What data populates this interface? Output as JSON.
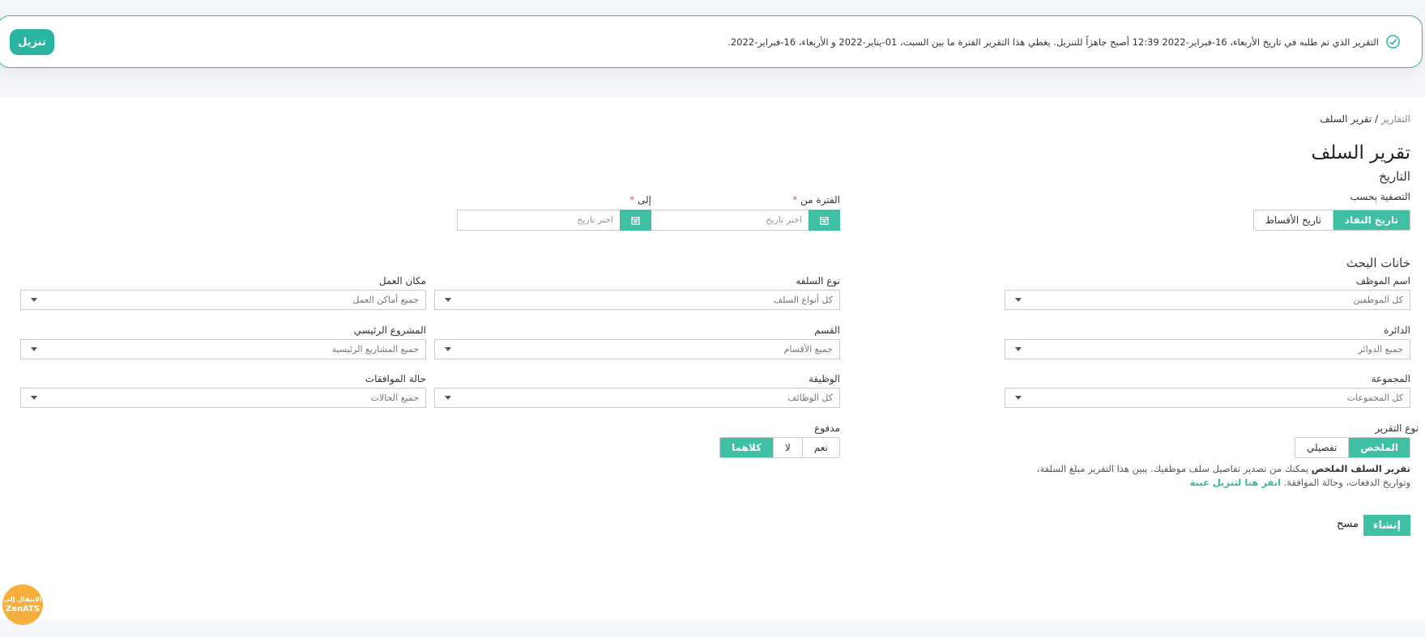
{
  "banner": {
    "message": "التقرير الذي تم طلبه في تاريخ الأربعاء، 16-فبراير-2022 12:39 أصبح جاهزاً للتنزيل. يغطي هذا التقرير الفترة ما بين السبت، 01-يناير-2022 و الأربعاء، 16-فبراير-2022.",
    "download_label": "تنزيل",
    "accent": "#29b59f"
  },
  "breadcrumb": {
    "root": "التقارير",
    "separator": " / ",
    "current": "تقرير السلف"
  },
  "page_title": "تقرير السلف",
  "date_section": {
    "title": "التاريخ",
    "filter_label": "التصفية بحسب",
    "filter_options": [
      "تاريخ النفاذ",
      "تاريخ الأقساط"
    ],
    "filter_selected": "تاريخ النفاذ",
    "from_label": "الفترة من",
    "to_label": "إلى",
    "required_mark": "*",
    "date_placeholder": "اختر تاريخ"
  },
  "search_section": {
    "title": "خانات البحث",
    "fields": {
      "employee": {
        "label": "اسم الموظف",
        "value": "كل الموظفين"
      },
      "loan_type": {
        "label": "نوع السلفه",
        "value": "كل أنواع السلف"
      },
      "workplace": {
        "label": "مكان العمل",
        "value": "جميع أماكن العمل"
      },
      "directorate": {
        "label": "الدائرة",
        "value": "جميع الدوائر"
      },
      "department": {
        "label": "القسم",
        "value": "جميع الأقسام"
      },
      "main_project": {
        "label": "المشروع الرئيسي",
        "value": "جميع المشاريع الرئيسية"
      },
      "group": {
        "label": "المجموعة",
        "value": "كل المجموعات"
      },
      "job": {
        "label": "الوظيفة",
        "value": "كل الوظائف"
      },
      "approval_status": {
        "label": "حالة الموافقات",
        "value": "جميع الحالات"
      }
    }
  },
  "report_type": {
    "label": "نوع التقرير",
    "options": [
      "الملخص",
      "تفصيلي"
    ],
    "selected": "الملخص"
  },
  "paid": {
    "label": "مدفوع",
    "options": [
      "نعم",
      "لا",
      "كلاهما"
    ],
    "selected": "كلاهما"
  },
  "description": {
    "bold": "تقرير السلف الملخص",
    "text": " يمكنك من تصدير تفاصيل سلف موظفيك. يبين هذا التقرير مبلغ السلفة، وتواريخ الدفعات، وحالة الموافقة. ",
    "link": "انقر هنا لتنزيل عينة"
  },
  "actions": {
    "create_label": "إنشاء",
    "clear_label": "مسح"
  },
  "zen_badge": {
    "line1": "الانتقال إلى",
    "line2": "ZenATS",
    "color": "#f6ae3c"
  },
  "colors": {
    "primary": "#3fbfa4",
    "required": "#e05555"
  }
}
